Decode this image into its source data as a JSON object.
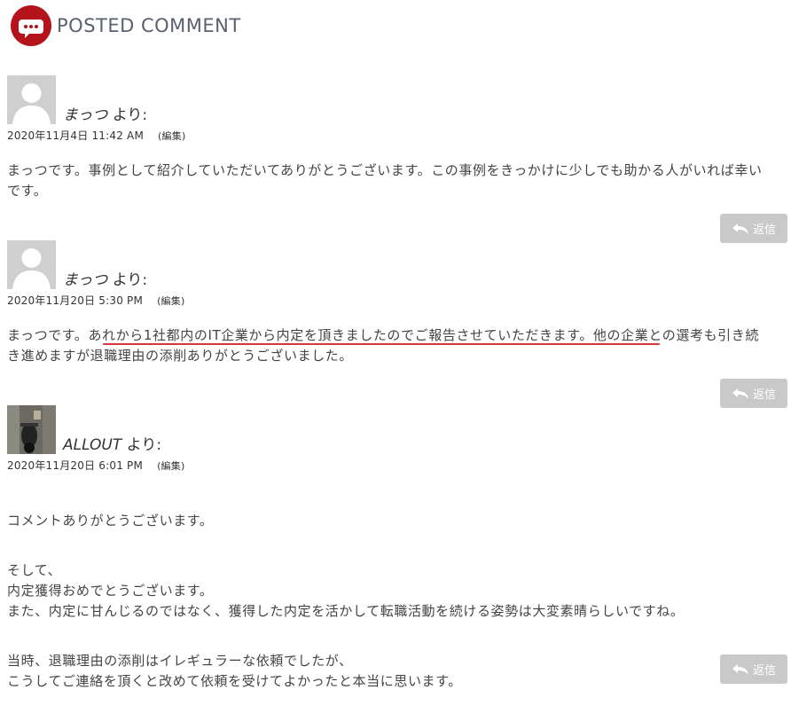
{
  "header": {
    "title": "POSTED COMMENT",
    "icon": "speech-bubble-icon",
    "icon_color": "#b4131b"
  },
  "comments": [
    {
      "author": "まっつ",
      "says": "より:",
      "date": "2020年11月4日 11:42 AM",
      "edit": "(編集)",
      "avatar": "default-avatar",
      "paragraphs": [
        "まっつです。事例として紹介していただいてありがとうございます。この事例をきっかけに少しでも助かる人がいれば幸いです。"
      ],
      "reply": "返信"
    },
    {
      "author": "まっつ",
      "says": "より:",
      "date": "2020年11月20日 5:30 PM",
      "edit": "(編集)",
      "avatar": "default-avatar",
      "paragraphs": [
        "まっつです。あれから1社都内のIT企業から内定を頂きましたのでご報告させていただきます。他の企業との選考も引き続き進めますが退職理由の添削ありがとうございました。"
      ],
      "reply": "返信"
    },
    {
      "author": "ALLOUT",
      "says": "より:",
      "date": "2020年11月20日 6:01 PM",
      "edit": "(編集)",
      "avatar": "photo-avatar",
      "paragraphs": [
        "コメントありがとうございます。",
        "そして、\n内定獲得おめでとうございます。\nまた、内定に甘んじるのではなく、獲得した内定を活かして転職活動を続ける姿勢は大変素晴らしいですね。",
        "当時、退職理由の添削はイレギュラーな依頼でしたが、\nこうしてご連絡を頂くと改めて依頼を受けてよかったと本当に思います。"
      ],
      "reply": "返信"
    }
  ],
  "colors": {
    "accent": "#b4131b",
    "reply_button": "#c9c9c9",
    "underline": "#d8343c"
  }
}
